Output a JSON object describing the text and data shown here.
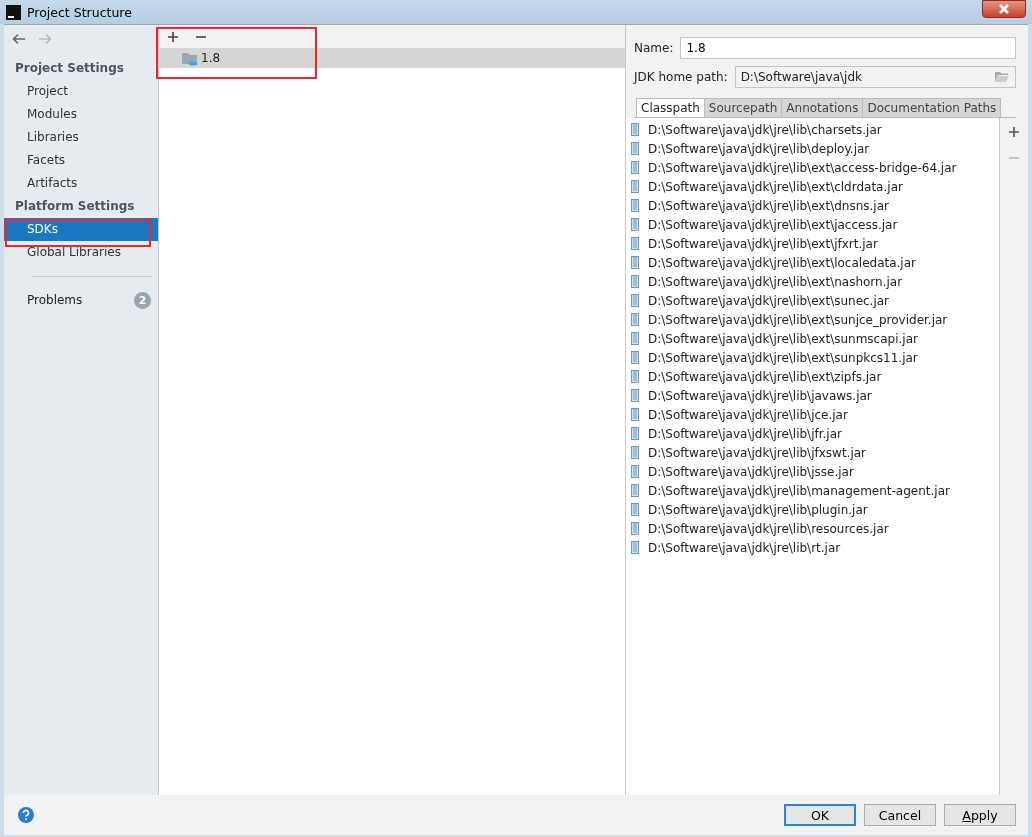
{
  "window": {
    "title": "Project Structure"
  },
  "sidebar": {
    "sections": [
      {
        "title": "Project Settings",
        "items": [
          {
            "label": "Project",
            "selected": false
          },
          {
            "label": "Modules",
            "selected": false
          },
          {
            "label": "Libraries",
            "selected": false
          },
          {
            "label": "Facets",
            "selected": false
          },
          {
            "label": "Artifacts",
            "selected": false
          }
        ]
      },
      {
        "title": "Platform Settings",
        "items": [
          {
            "label": "SDKs",
            "selected": true
          },
          {
            "label": "Global Libraries",
            "selected": false
          }
        ]
      }
    ],
    "problems": {
      "label": "Problems",
      "count": "2"
    }
  },
  "sdk_list": {
    "items": [
      {
        "label": "1.8",
        "selected": true
      }
    ]
  },
  "details": {
    "name_label": "Name:",
    "name_value": "1.8",
    "home_label": "JDK home path:",
    "home_value": "D:\\Software\\java\\jdk",
    "tabs": [
      {
        "label": "Classpath",
        "selected": true
      },
      {
        "label": "Sourcepath",
        "selected": false
      },
      {
        "label": "Annotations",
        "selected": false
      },
      {
        "label": "Documentation Paths",
        "selected": false
      }
    ],
    "paths": [
      "D:\\Software\\java\\jdk\\jre\\lib\\charsets.jar",
      "D:\\Software\\java\\jdk\\jre\\lib\\deploy.jar",
      "D:\\Software\\java\\jdk\\jre\\lib\\ext\\access-bridge-64.jar",
      "D:\\Software\\java\\jdk\\jre\\lib\\ext\\cldrdata.jar",
      "D:\\Software\\java\\jdk\\jre\\lib\\ext\\dnsns.jar",
      "D:\\Software\\java\\jdk\\jre\\lib\\ext\\jaccess.jar",
      "D:\\Software\\java\\jdk\\jre\\lib\\ext\\jfxrt.jar",
      "D:\\Software\\java\\jdk\\jre\\lib\\ext\\localedata.jar",
      "D:\\Software\\java\\jdk\\jre\\lib\\ext\\nashorn.jar",
      "D:\\Software\\java\\jdk\\jre\\lib\\ext\\sunec.jar",
      "D:\\Software\\java\\jdk\\jre\\lib\\ext\\sunjce_provider.jar",
      "D:\\Software\\java\\jdk\\jre\\lib\\ext\\sunmscapi.jar",
      "D:\\Software\\java\\jdk\\jre\\lib\\ext\\sunpkcs11.jar",
      "D:\\Software\\java\\jdk\\jre\\lib\\ext\\zipfs.jar",
      "D:\\Software\\java\\jdk\\jre\\lib\\javaws.jar",
      "D:\\Software\\java\\jdk\\jre\\lib\\jce.jar",
      "D:\\Software\\java\\jdk\\jre\\lib\\jfr.jar",
      "D:\\Software\\java\\jdk\\jre\\lib\\jfxswt.jar",
      "D:\\Software\\java\\jdk\\jre\\lib\\jsse.jar",
      "D:\\Software\\java\\jdk\\jre\\lib\\management-agent.jar",
      "D:\\Software\\java\\jdk\\jre\\lib\\plugin.jar",
      "D:\\Software\\java\\jdk\\jre\\lib\\resources.jar",
      "D:\\Software\\java\\jdk\\jre\\lib\\rt.jar"
    ]
  },
  "buttons": [
    {
      "label": "OK",
      "kind": "default"
    },
    {
      "label": "Cancel",
      "kind": "plain"
    },
    {
      "label": "Apply",
      "kind": "mnemonic"
    }
  ]
}
